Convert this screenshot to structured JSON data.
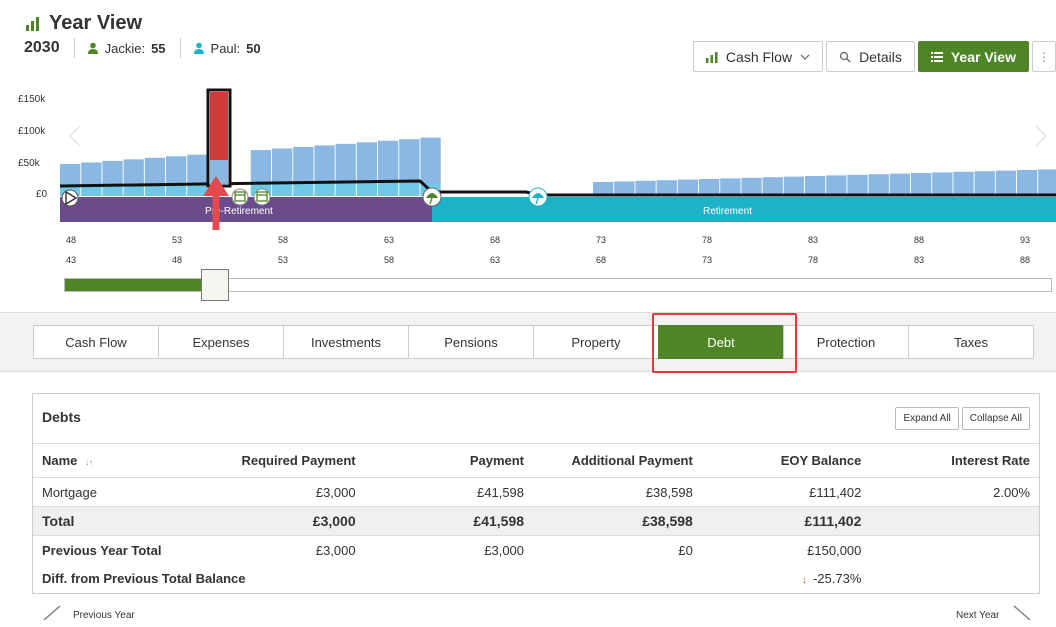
{
  "header": {
    "title": "Year View",
    "year": "2030",
    "people": [
      {
        "name": "Jackie:",
        "age": "55",
        "color": "#4e8526"
      },
      {
        "name": "Paul:",
        "age": "50",
        "color": "#1bb3c9"
      }
    ],
    "views": {
      "cash_flow": "Cash Flow",
      "details": "Details",
      "year_view": "Year View"
    }
  },
  "chart": {
    "y_ticks": [
      "£150k",
      "£100k",
      "£50k",
      "£0"
    ],
    "phases": {
      "pre": "Pre-Retirement",
      "post": "Retirement"
    },
    "ages_row1": [
      "48",
      "53",
      "58",
      "63",
      "68",
      "73",
      "78",
      "83",
      "88",
      "93"
    ],
    "ages_row2": [
      "43",
      "48",
      "53",
      "58",
      "63",
      "68",
      "73",
      "78",
      "83",
      "88"
    ],
    "scroll_position": 0.17,
    "colors": {
      "bar": "#8ab8e3",
      "highlight": "#d43a3a",
      "pre": "#6c4b8d",
      "post": "#1eb2c9",
      "arrow": "#e24a4e"
    }
  },
  "tabs": [
    "Cash Flow",
    "Expenses",
    "Investments",
    "Pensions",
    "Property",
    "Debt",
    "Protection",
    "Taxes"
  ],
  "active_tab": "Debt",
  "debts": {
    "title": "Debts",
    "expand_all": "Expand All",
    "collapse_all": "Collapse All",
    "columns": [
      "Name",
      "Required Payment",
      "Payment",
      "Additional Payment",
      "EOY Balance",
      "Interest Rate"
    ],
    "rows": [
      [
        "Mortgage",
        "£3,000",
        "£41,598",
        "£38,598",
        "£111,402",
        "2.00%"
      ]
    ],
    "total": [
      "Total",
      "£3,000",
      "£41,598",
      "£38,598",
      "£111,402",
      ""
    ],
    "previous": [
      "Previous Year Total",
      "£3,000",
      "£3,000",
      "£0",
      "£150,000",
      ""
    ],
    "diff": {
      "label": "Diff. from Previous Total Balance",
      "value": "-25.73%"
    }
  },
  "pager": {
    "prev": "Previous Year",
    "next": "Next Year"
  }
}
